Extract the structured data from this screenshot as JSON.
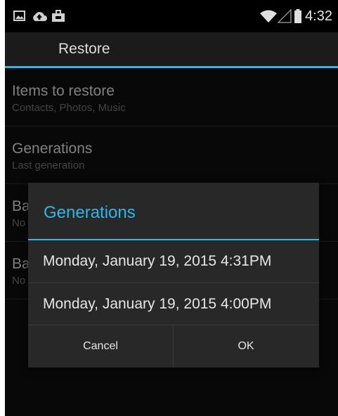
{
  "status_bar": {
    "icons": [
      "gallery-icon",
      "cloud-upload-icon",
      "briefcase-icon"
    ],
    "right_icons": [
      "wifi-icon",
      "signal-icon",
      "battery-icon"
    ],
    "time": "4:32"
  },
  "action_bar": {
    "title": "Restore"
  },
  "preferences": [
    {
      "title": "Items to restore",
      "summary": "Contacts, Photos, Music"
    },
    {
      "title": "Generations",
      "summary": "Last generation"
    },
    {
      "title": "Ba",
      "summary": "No"
    },
    {
      "title": "Ba",
      "summary": "No"
    }
  ],
  "dialog": {
    "title": "Generations",
    "items": [
      "Monday, January 19, 2015 4:31PM",
      "Monday, January 19, 2015 4:00PM"
    ],
    "cancel_label": "Cancel",
    "ok_label": "OK"
  },
  "colors": {
    "accent": "#33b5e5",
    "background": "#0d0d0d",
    "dialog": "#282828"
  }
}
